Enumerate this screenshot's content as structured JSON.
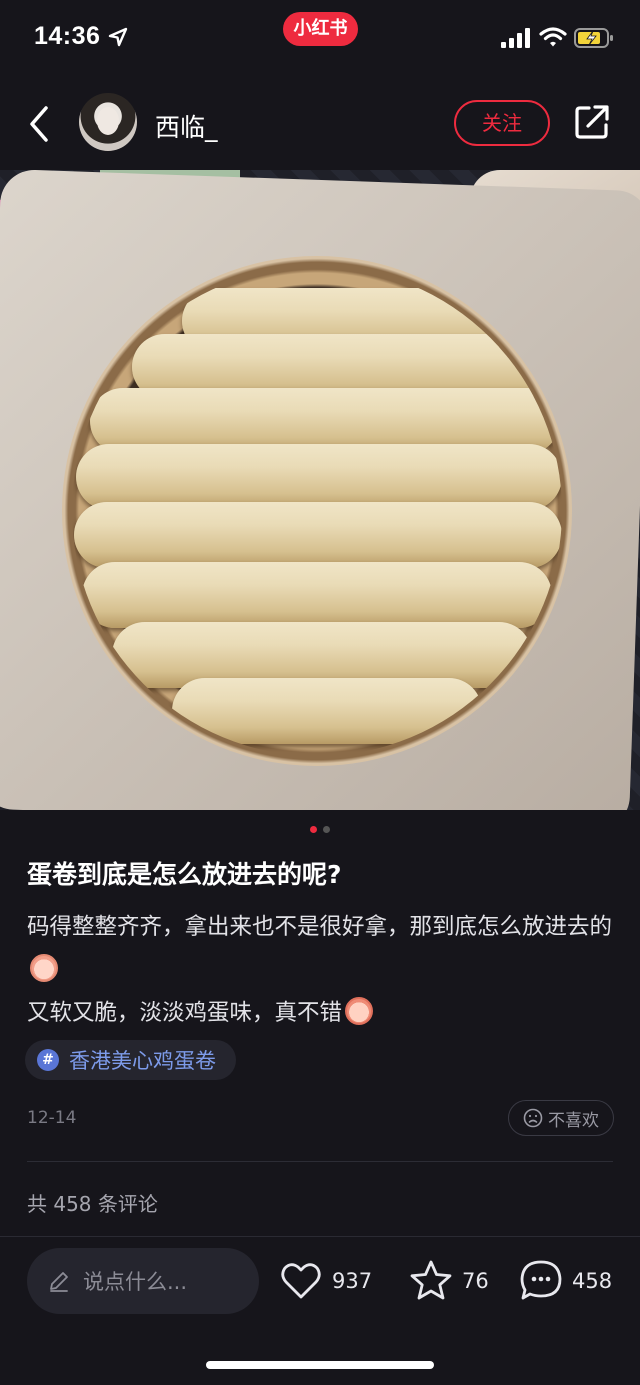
{
  "status_bar": {
    "time": "14:36",
    "brand": "小红书",
    "icons": [
      "location-arrow-icon",
      "signal-icon",
      "wifi-icon",
      "battery-charging-icon"
    ]
  },
  "header": {
    "username": "西临_",
    "follow_label": "关注",
    "icons": [
      "back-arrow-icon",
      "share-icon"
    ]
  },
  "carousel": {
    "page_count": 2,
    "current_page": 1
  },
  "post": {
    "title": "蛋卷到底是怎么放进去的呢?",
    "body_line1": "码得整整齐齐，拿出来也不是很好拿，那到底怎么放进去的",
    "body_line2": "又软又脆，淡淡鸡蛋味，真不错",
    "tag": "香港美心鸡蛋卷",
    "date": "12-14",
    "dislike_label": "不喜欢"
  },
  "comments": {
    "count_label": "共 458 条评论"
  },
  "bottom_bar": {
    "input_placeholder": "说点什么...",
    "likes": "937",
    "collects": "76",
    "comments": "458"
  },
  "colors": {
    "accent": "#ee2b3f",
    "background": "#16151b",
    "tag_text": "#7d9bea"
  }
}
